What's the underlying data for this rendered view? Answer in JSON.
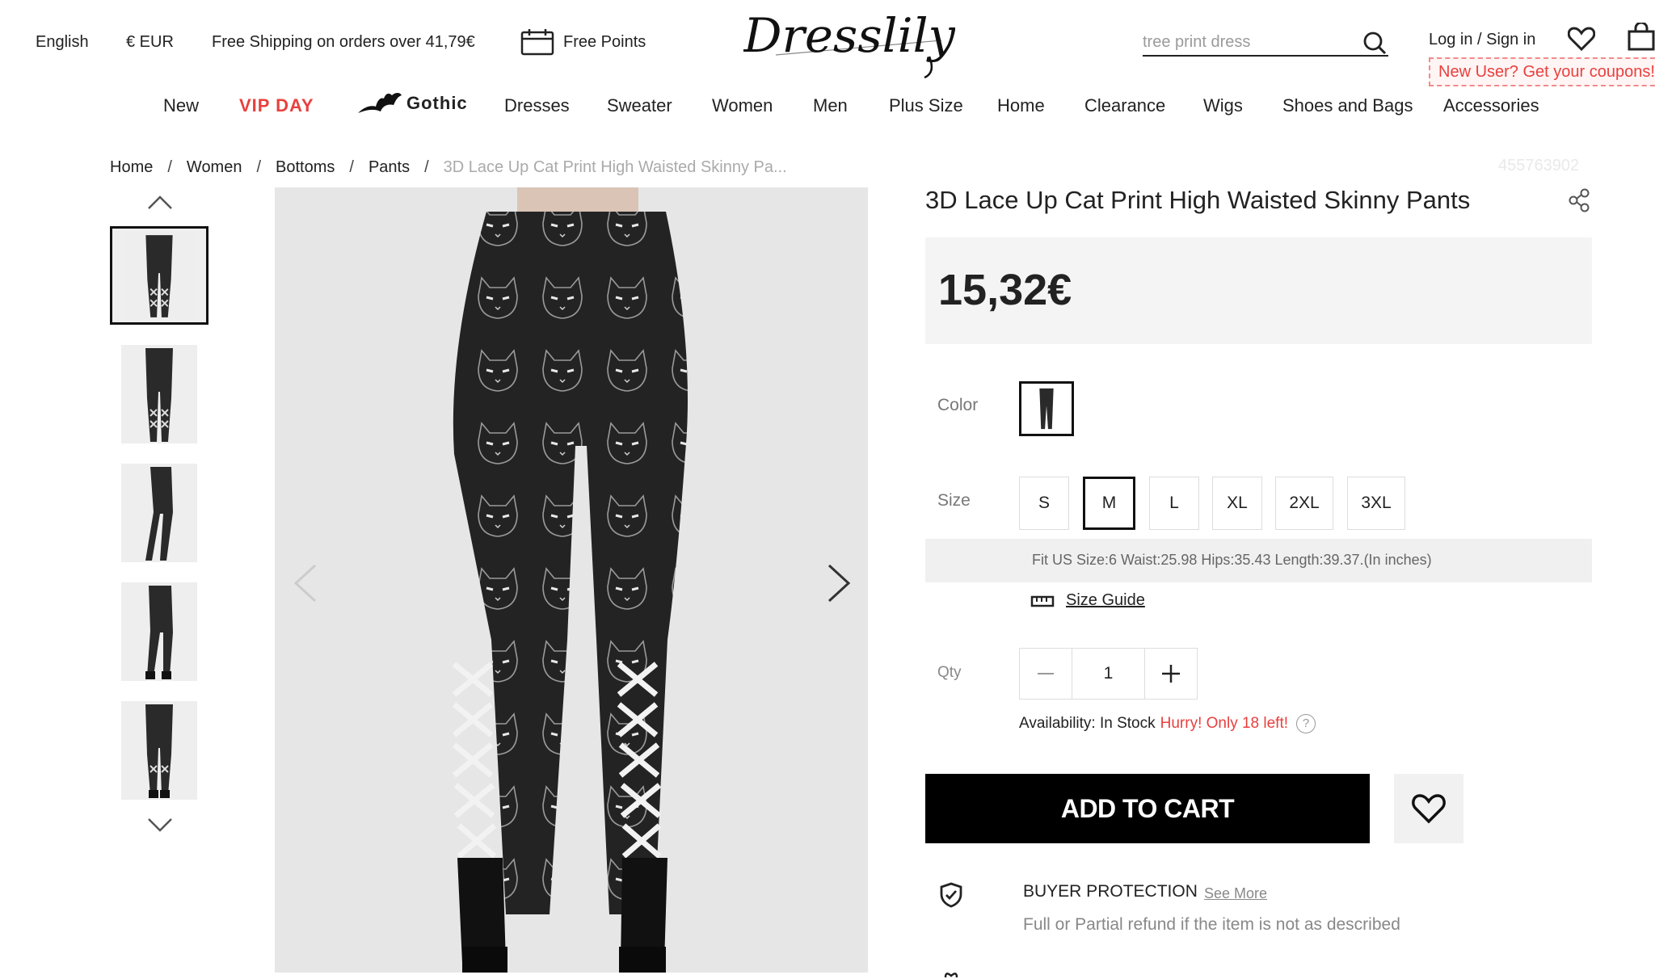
{
  "topbar": {
    "language": "English",
    "currency": "€ EUR",
    "shipping": "Free Shipping on orders over 41,79€",
    "points": "Free Points",
    "logo": "Dresslily",
    "search_placeholder": "tree print dress",
    "login": "Log in / Sign in",
    "coupon": "New User? Get your coupons!"
  },
  "nav": {
    "items": [
      "New",
      "VIP DAY",
      "Gothic",
      "Dresses",
      "Sweater",
      "Women",
      "Men",
      "Plus Size",
      "Home",
      "Clearance",
      "Wigs",
      "Shoes and Bags",
      "Accessories"
    ]
  },
  "breadcrumb": {
    "items": [
      "Home",
      "Women",
      "Bottoms",
      "Pants"
    ],
    "separator": "/",
    "current": "3D Lace Up Cat Print High Waisted Skinny Pa..."
  },
  "product": {
    "sku": "455763902",
    "title": "3D Lace Up Cat Print High Waisted Skinny Pants",
    "price": "15,32€",
    "color_label": "Color",
    "size_label": "Size",
    "sizes": [
      "S",
      "M",
      "L",
      "XL",
      "2XL",
      "3XL"
    ],
    "selected_size": "M",
    "fit_info": "Fit US Size:6   Waist:25.98   Hips:35.43   Length:39.37.(In inches)",
    "size_guide": "Size Guide",
    "qty_label": "Qty",
    "qty_value": "1",
    "availability_label": "Availability: In Stock",
    "hurry": "Hurry! Only 18 left!",
    "help_icon": "?",
    "add_to_cart": "ADD TO CART",
    "buyer_protection_title": "BUYER PROTECTION",
    "see_more": "See More",
    "buyer_protection_desc": "Full or Partial refund if the item is not as described"
  },
  "gallery": {
    "thumbnail_count": 5,
    "active_index": 0
  },
  "colors": {
    "accent_red": "#e8403e",
    "button_black": "#000000",
    "price_bg": "#f4f4f4"
  }
}
